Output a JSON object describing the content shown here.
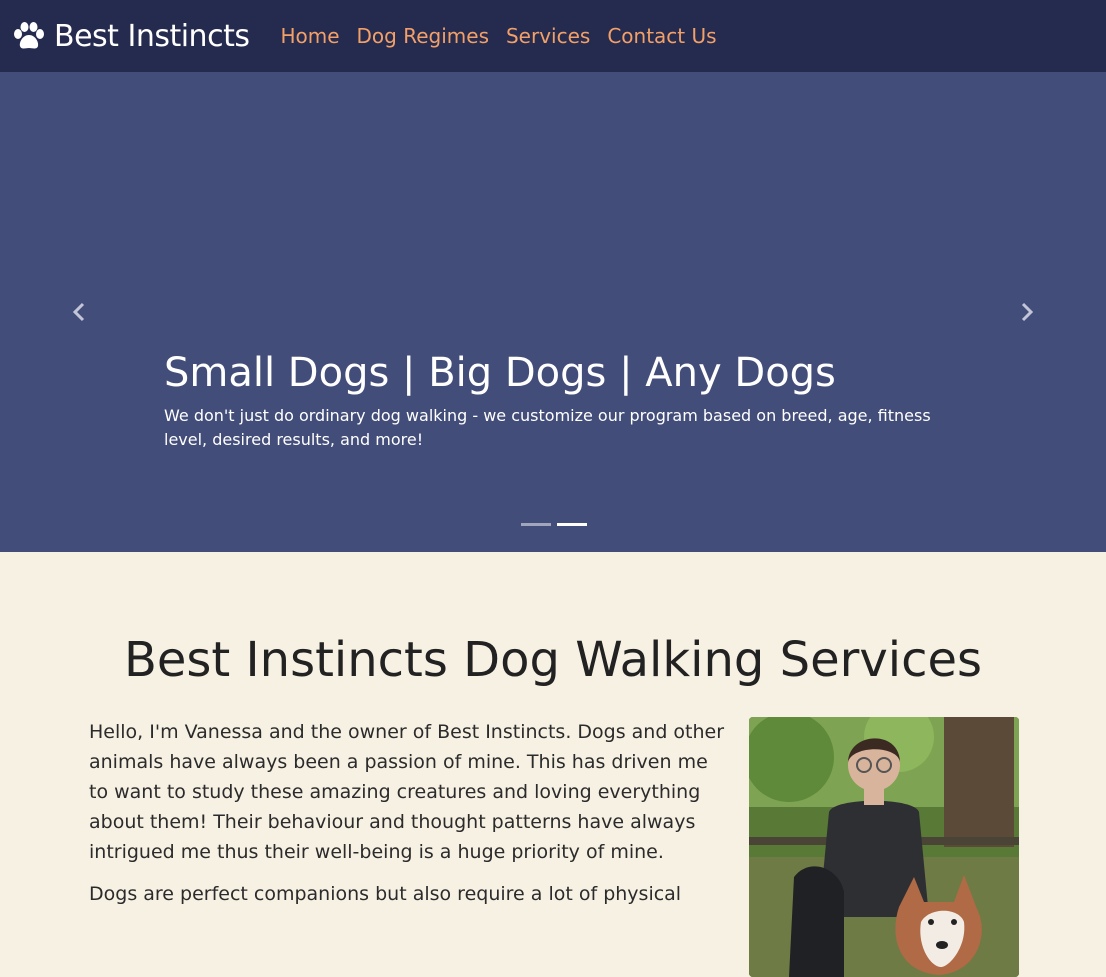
{
  "navbar": {
    "brand": "Best Instincts",
    "brand_icon": "paw-icon",
    "links": [
      "Home",
      "Dog Regimes",
      "Services",
      "Contact Us"
    ],
    "link_color": "#f3a068",
    "background": "#252b4f"
  },
  "carousel": {
    "background": "#434d79",
    "heading": "Small Dogs | Big Dogs | Any Dogs",
    "text": "We don't just do ordinary dog walking - we customize our program based on breed, age, fitness level, desired results, and more!",
    "prev_icon": "chevron-left-icon",
    "next_icon": "chevron-right-icon",
    "slide_count": 2,
    "active_slide": 2
  },
  "about": {
    "title": "Best Instincts Dog Walking Services",
    "paragraphs": [
      "Hello, I'm Vanessa and the owner of Best Instincts. Dogs and other animals have always been a passion of mine. This has driven me to want to study these amazing creatures and loving everything about them! Their behaviour and thought patterns have always intrigued me thus their well-being is a huge priority of mine.",
      "Dogs are perfect companions but also require a lot of physical"
    ]
  }
}
